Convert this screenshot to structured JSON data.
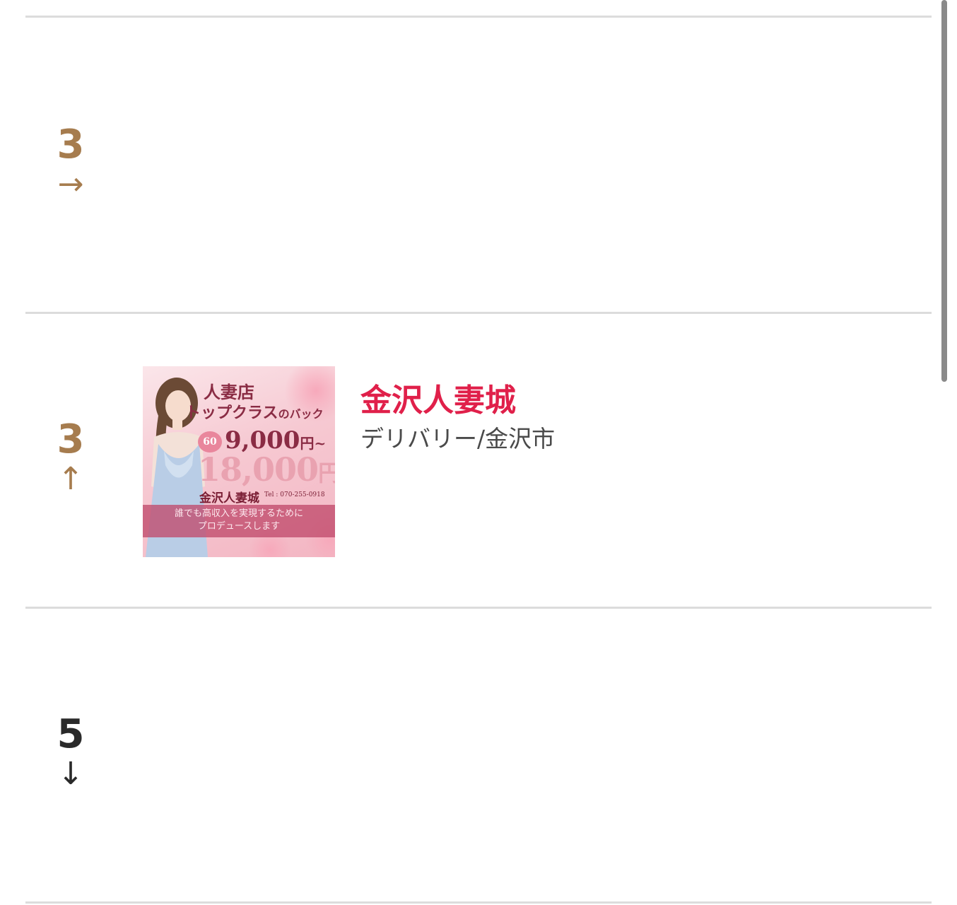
{
  "rankings": [
    {
      "rank": "3",
      "trend_arrow": "→",
      "trend_color": "#a67c4e"
    },
    {
      "rank": "3",
      "trend_arrow": "↑",
      "trend_color": "#a67c4e",
      "shop": {
        "name": "金沢人妻城",
        "category": "デリバリー/金沢市",
        "name_color": "#e0204a",
        "banner": {
          "headline_1": "人妻店",
          "headline_2": "トップクラス",
          "headline_2_suffix": "のバック",
          "badge": "60",
          "price_low": "9,000",
          "price_low_suffix": "円~",
          "price_high": "18,000",
          "price_high_suffix": "円",
          "brand": "金沢人妻城",
          "tel": "Tel : 070-255-0918",
          "tagline_1": "誰でも高収入を実現するために",
          "tagline_2": "プロデュースします"
        }
      }
    },
    {
      "rank": "5",
      "trend_arrow": "↓",
      "trend_color": "#2a2a2a"
    }
  ]
}
